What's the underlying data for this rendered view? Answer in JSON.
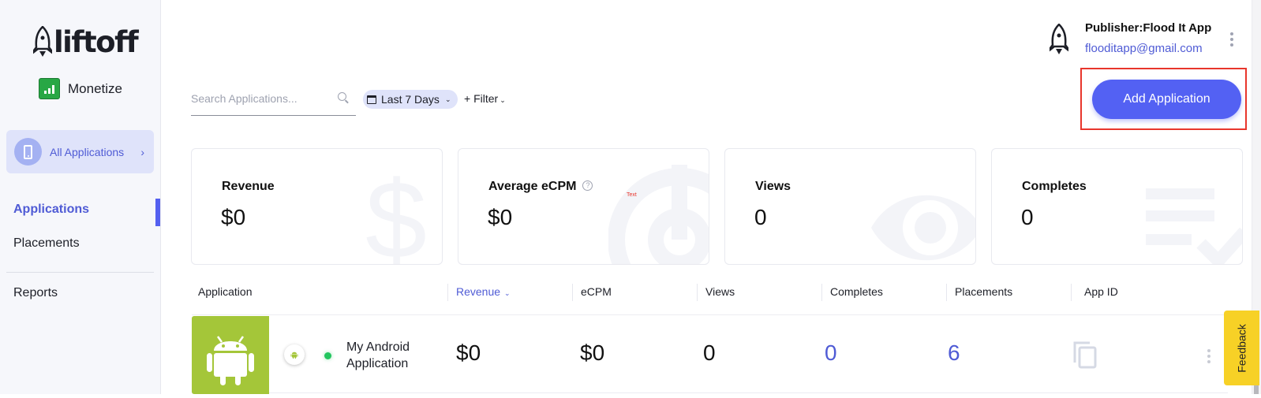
{
  "brand": {
    "logo_text": "liftoff",
    "product": "Monetize"
  },
  "sidebar": {
    "app_selector": {
      "label": "All Applications",
      "icon": "phone-icon"
    },
    "items": [
      {
        "label": "Applications",
        "active": true
      },
      {
        "label": "Placements",
        "active": false
      },
      {
        "label": "Reports",
        "active": false
      }
    ]
  },
  "header": {
    "publisher_label": "Publisher:Flood It App",
    "email": "flooditapp@gmail.com",
    "add_button": "Add Application"
  },
  "toolbar": {
    "search_placeholder": "Search Applications...",
    "search_value": "",
    "date_range": "Last 7 Days",
    "filter_label": "+ Filter"
  },
  "stats": [
    {
      "title": "Revenue",
      "value": "$0",
      "icon": "dollar-icon"
    },
    {
      "title": "Average eCPM",
      "value": "$0",
      "icon": "target-icon",
      "annotation": "Text"
    },
    {
      "title": "Views",
      "value": "0",
      "icon": "eye-icon"
    },
    {
      "title": "Completes",
      "value": "0",
      "icon": "list-check-icon"
    }
  ],
  "table": {
    "columns": [
      "Application",
      "Revenue",
      "eCPM",
      "Views",
      "Completes",
      "Placements",
      "App ID"
    ],
    "sorted_column": "Revenue",
    "rows": [
      {
        "name": "My Android Application",
        "platform": "android",
        "status": "active",
        "revenue": "$0",
        "ecpm": "$0",
        "views": "0",
        "completes": "0",
        "placements": "6"
      }
    ]
  },
  "feedback_label": "Feedback",
  "colors": {
    "accent": "#5361f3",
    "link": "#4f5bd5",
    "android": "#a4c639",
    "status_active": "#22c55e",
    "feedback": "#f7d126",
    "highlight_box": "#e8362c"
  }
}
